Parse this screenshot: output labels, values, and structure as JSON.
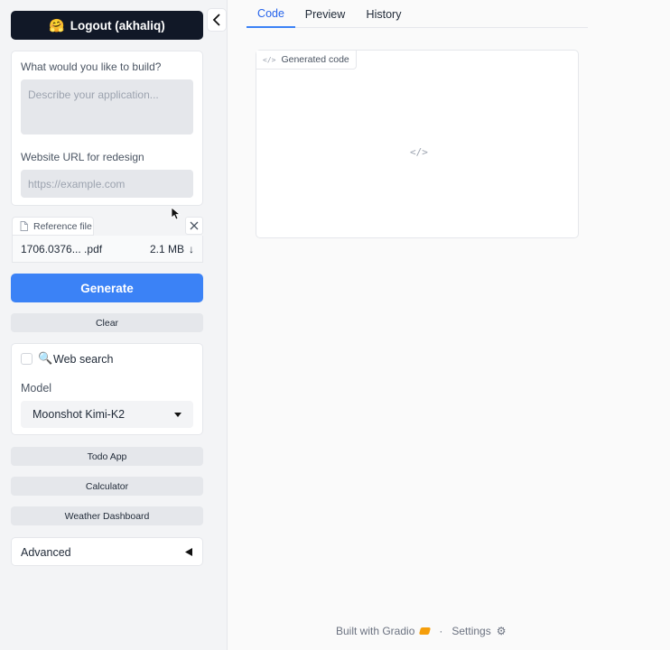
{
  "sidebar": {
    "logout_label": "Logout (akhaliq)",
    "prompt": {
      "label": "What would you like to build?",
      "placeholder": "Describe your application..."
    },
    "url": {
      "label": "Website URL for redesign",
      "placeholder": "https://example.com"
    },
    "file": {
      "chip_label": "Reference file",
      "name": "1706.0376... .pdf",
      "size": "2.1 MB"
    },
    "generate_label": "Generate",
    "clear_label": "Clear",
    "web_search_label": "Web search",
    "model_label": "Model",
    "model_value": "Moonshot Kimi-K2",
    "examples": [
      "Todo App",
      "Calculator",
      "Weather Dashboard"
    ],
    "advanced_label": "Advanced"
  },
  "main": {
    "tabs": [
      {
        "label": "Code",
        "active": true
      },
      {
        "label": "Preview",
        "active": false
      },
      {
        "label": "History",
        "active": false
      }
    ],
    "code_box_label": "Generated code"
  },
  "footer": {
    "built_with": "Built with Gradio",
    "separator": "·",
    "settings": "Settings"
  },
  "colors": {
    "primary": "#3b82f6",
    "dark_button": "#111827"
  }
}
